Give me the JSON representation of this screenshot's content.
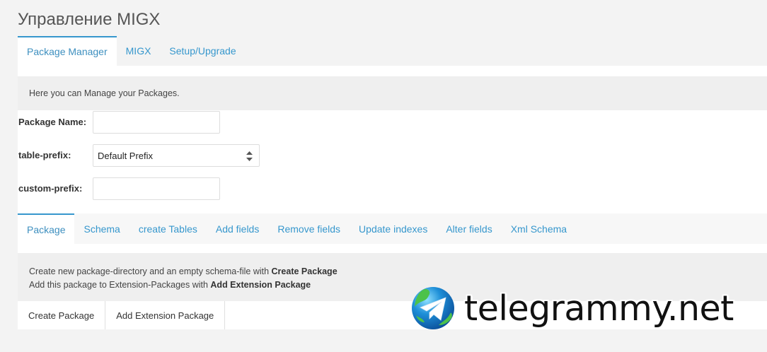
{
  "page": {
    "title": "Управление MIGX"
  },
  "top_tabs": [
    {
      "label": "Package Manager",
      "active": true
    },
    {
      "label": "MIGX",
      "active": false
    },
    {
      "label": "Setup/Upgrade",
      "active": false
    }
  ],
  "info": {
    "text": "Here you can Manage your Packages."
  },
  "form": {
    "package_name_label": "Package Name:",
    "package_name_value": "",
    "table_prefix_label": "table-prefix:",
    "table_prefix_value": "Default Prefix",
    "custom_prefix_label": "custom-prefix:",
    "custom_prefix_value": ""
  },
  "sub_tabs": [
    {
      "label": "Package",
      "active": true
    },
    {
      "label": "Schema",
      "active": false
    },
    {
      "label": "create Tables",
      "active": false
    },
    {
      "label": "Add fields",
      "active": false
    },
    {
      "label": "Remove fields",
      "active": false
    },
    {
      "label": "Update indexes",
      "active": false
    },
    {
      "label": "Alter fields",
      "active": false
    },
    {
      "label": "Xml Schema",
      "active": false
    }
  ],
  "description": {
    "line1_prefix": "Create new package-directory and an empty schema-file with ",
    "line1_bold": "Create Package",
    "line2_prefix": "Add this package to Extension-Packages with ",
    "line2_bold": "Add Extension Package"
  },
  "buttons": {
    "create_package": "Create Package",
    "add_extension_package": "Add Extension Package"
  },
  "watermark": {
    "text": "telegrammy.net",
    "icon": "telegram-globe-icon"
  },
  "colors": {
    "accent": "#3697cd",
    "background": "#f3f3f3",
    "info_bar": "#efefef"
  }
}
